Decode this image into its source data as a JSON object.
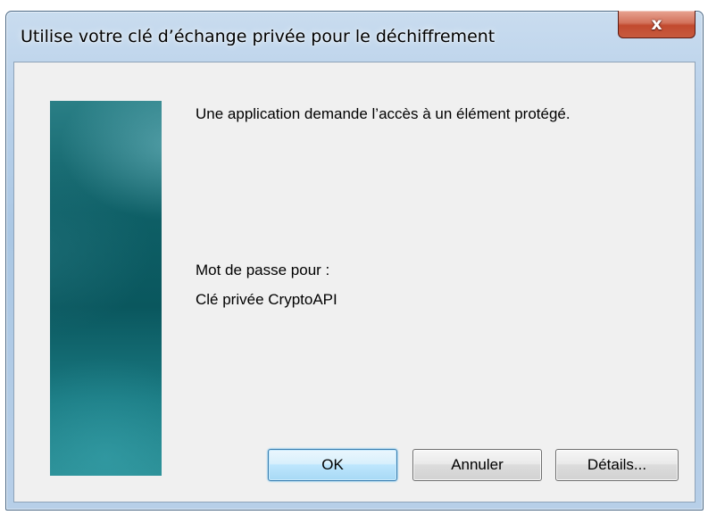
{
  "window": {
    "title": "Utilise votre clé d’échange privée pour le déchiffrement",
    "close_glyph": "x"
  },
  "dialog": {
    "message": "Une application demande l’accès à un élément protégé.",
    "password_label": "Mot de passe pour :",
    "key_name": "Clé privée CryptoAPI"
  },
  "buttons": {
    "ok_label": "OK",
    "cancel_label": "Annuler",
    "details_label": "Détails..."
  },
  "colors": {
    "titlebar": "#b9d1ea",
    "close_button": "#c75a3e",
    "client_background": "#f0f0f0",
    "banner": "#0e5f66",
    "default_button_border": "#3c7fb1"
  },
  "icons": {
    "close": "close-icon"
  }
}
